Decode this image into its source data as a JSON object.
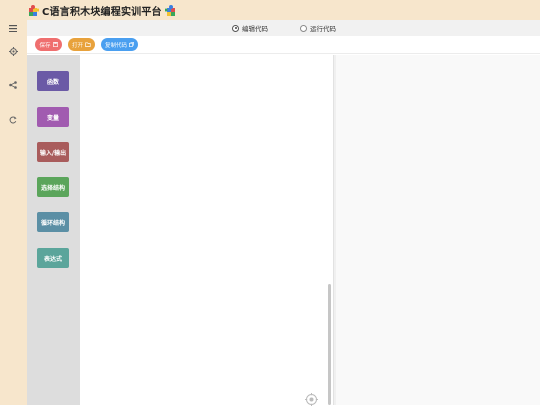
{
  "header": {
    "title": "C语言积木块编程实训平台",
    "logo_icon": "puzzle-piece-icon"
  },
  "rail": {
    "items": [
      {
        "icon": "menu-icon"
      },
      {
        "icon": "gear-icon"
      },
      {
        "icon": "share-icon"
      },
      {
        "icon": "refresh-icon"
      }
    ]
  },
  "modes": {
    "edit": {
      "label": "编辑代码",
      "selected": true
    },
    "run": {
      "label": "运行代码",
      "selected": false
    }
  },
  "toolbar": {
    "save_label": "保存",
    "open_label": "打开",
    "copy_label": "复制代码",
    "colors": {
      "save": "#ef6f6f",
      "open": "#e8a23c",
      "copy": "#4a9ff0"
    }
  },
  "toolbox": {
    "categories": [
      {
        "label": "函数",
        "color": "#6b5aa6"
      },
      {
        "label": "变量",
        "color": "#a15bb0"
      },
      {
        "label": "输入/输出",
        "color": "#a95c5c"
      },
      {
        "label": "选择结构",
        "color": "#5ba55b"
      },
      {
        "label": "循环结构",
        "color": "#5b8fa5"
      },
      {
        "label": "表达式",
        "color": "#5ba59b"
      }
    ]
  }
}
